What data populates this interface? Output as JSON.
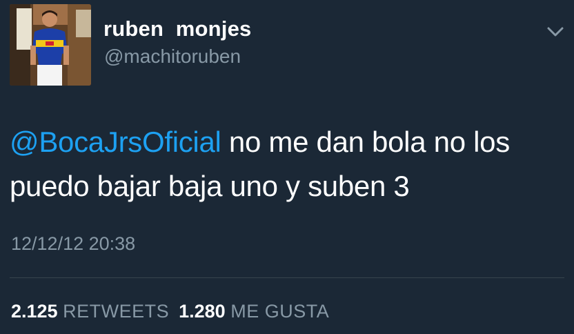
{
  "tweet": {
    "author": {
      "display_name": "ruben  monjes",
      "handle": "@machitoruben"
    },
    "mention": "@BocaJrsOficial",
    "text": " no me dan bola no los puedo bajar baja uno y suben 3",
    "timestamp": "12/12/12 20:38",
    "stats": {
      "retweets_count": "2.125",
      "retweets_label": "RETWEETS",
      "likes_count": "1.280",
      "likes_label": "ME GUSTA"
    },
    "icons": {
      "menu": "chevron-down-icon"
    },
    "colors": {
      "background": "#1b2836",
      "mention": "#1da1f2",
      "secondary_text": "#8899a6",
      "divider": "#38444d"
    }
  }
}
